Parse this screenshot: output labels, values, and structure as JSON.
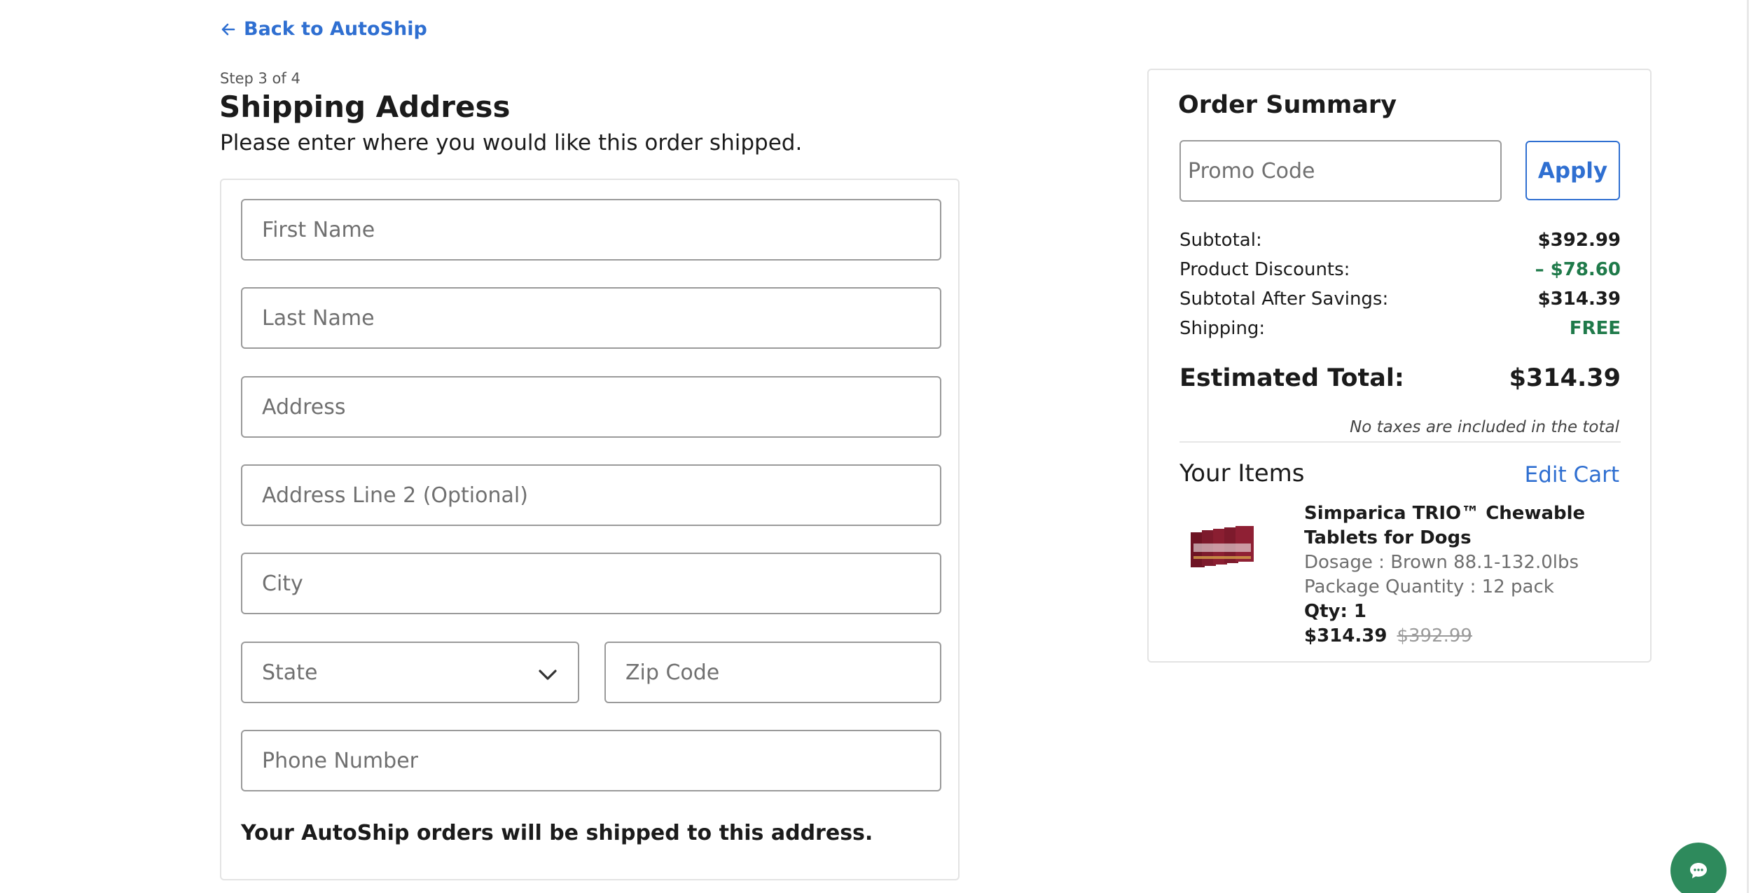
{
  "nav": {
    "back_label": "Back to AutoShip"
  },
  "checkout": {
    "step": "Step 3 of 4",
    "title": "Shipping Address",
    "subtitle": "Please enter where you would like this order shipped."
  },
  "form": {
    "first_name_placeholder": "First Name",
    "last_name_placeholder": "Last Name",
    "address_placeholder": "Address",
    "address2_placeholder": "Address Line 2 (Optional)",
    "city_placeholder": "City",
    "state_label": "State",
    "zip_placeholder": "Zip Code",
    "phone_placeholder": "Phone Number",
    "note": "Your AutoShip orders will be shipped to this address."
  },
  "summary": {
    "title": "Order Summary",
    "promo_placeholder": "Promo Code",
    "apply_label": "Apply",
    "lines": [
      {
        "label": "Subtotal:",
        "value": "$392.99"
      },
      {
        "label": "Product Discounts:",
        "value": "– $78.60"
      },
      {
        "label": "Subtotal After Savings:",
        "value": "$314.39"
      },
      {
        "label": "Shipping:",
        "value": "FREE"
      }
    ],
    "total_label": "Estimated Total:",
    "total_value": "$314.39",
    "tax_note": "No taxes are included in the total",
    "items_title": "Your Items",
    "edit_cart_label": "Edit Cart",
    "item": {
      "name": "Simparica TRIO™ Chewable Tablets for Dogs",
      "dosage": "Dosage : Brown 88.1-132.0lbs",
      "package": "Package Quantity : 12 pack",
      "qty": "Qty: 1",
      "price": "$314.39",
      "original_price": "$392.99"
    }
  },
  "colors": {
    "link_blue": "#2f6fd1",
    "savings_green": "#1f7a4a",
    "chat_green": "#2e8a5c"
  },
  "icons": {
    "back": "arrow-left-icon",
    "select": "chevron-down-icon",
    "chat": "chat-bubble-icon"
  }
}
